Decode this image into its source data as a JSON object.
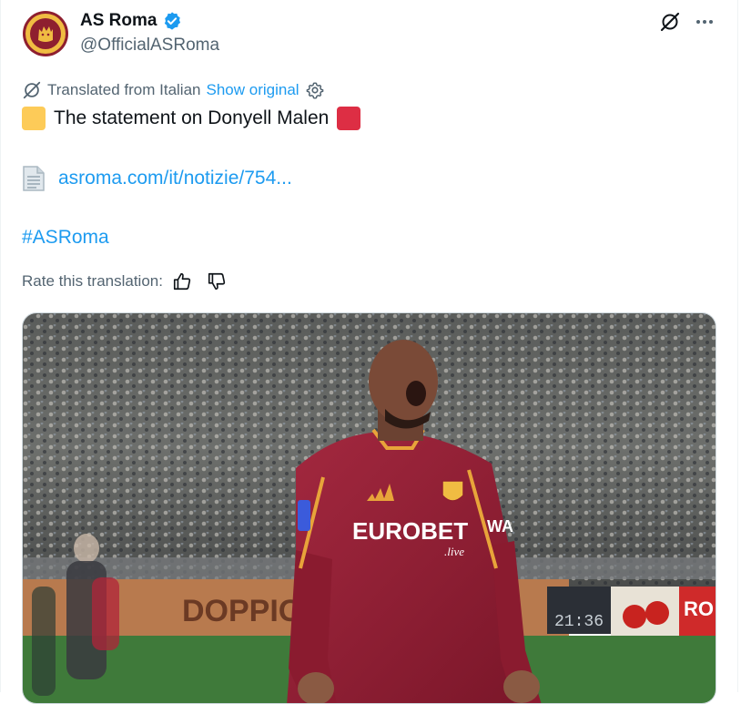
{
  "author": {
    "name": "AS Roma",
    "handle": "@OfficialASRoma"
  },
  "translation": {
    "note": "Translated from Italian",
    "show_original": "Show original"
  },
  "tweet": {
    "text": "The statement on Donyell Malen",
    "link": "asroma.com/it/notizie/754...",
    "hashtag": "#ASRoma"
  },
  "rating": {
    "label": "Rate this translation:"
  },
  "media": {
    "shirt_sponsor": "EUROBET",
    "shirt_sponsor_sub": ".live",
    "shirt_side": "WA",
    "billboard_left": "DOPPIO",
    "billboard_scoreboard": "21:36",
    "billboard_right": "RO"
  },
  "colors": {
    "link": "#1d9bf0",
    "text": "#0f1419",
    "muted": "#536471",
    "roma_red": "#8e1f2f",
    "roma_gold": "#f0bc42",
    "emoji_yellow": "#fdcb58",
    "emoji_red": "#dd2e44"
  },
  "icons": {
    "verified": "verified-badge-icon",
    "translate": "translate-icon",
    "more": "more-icon",
    "settings": "gear-icon",
    "document": "page-icon",
    "thumbs_up": "thumbs-up-icon",
    "thumbs_down": "thumbs-down-icon"
  }
}
